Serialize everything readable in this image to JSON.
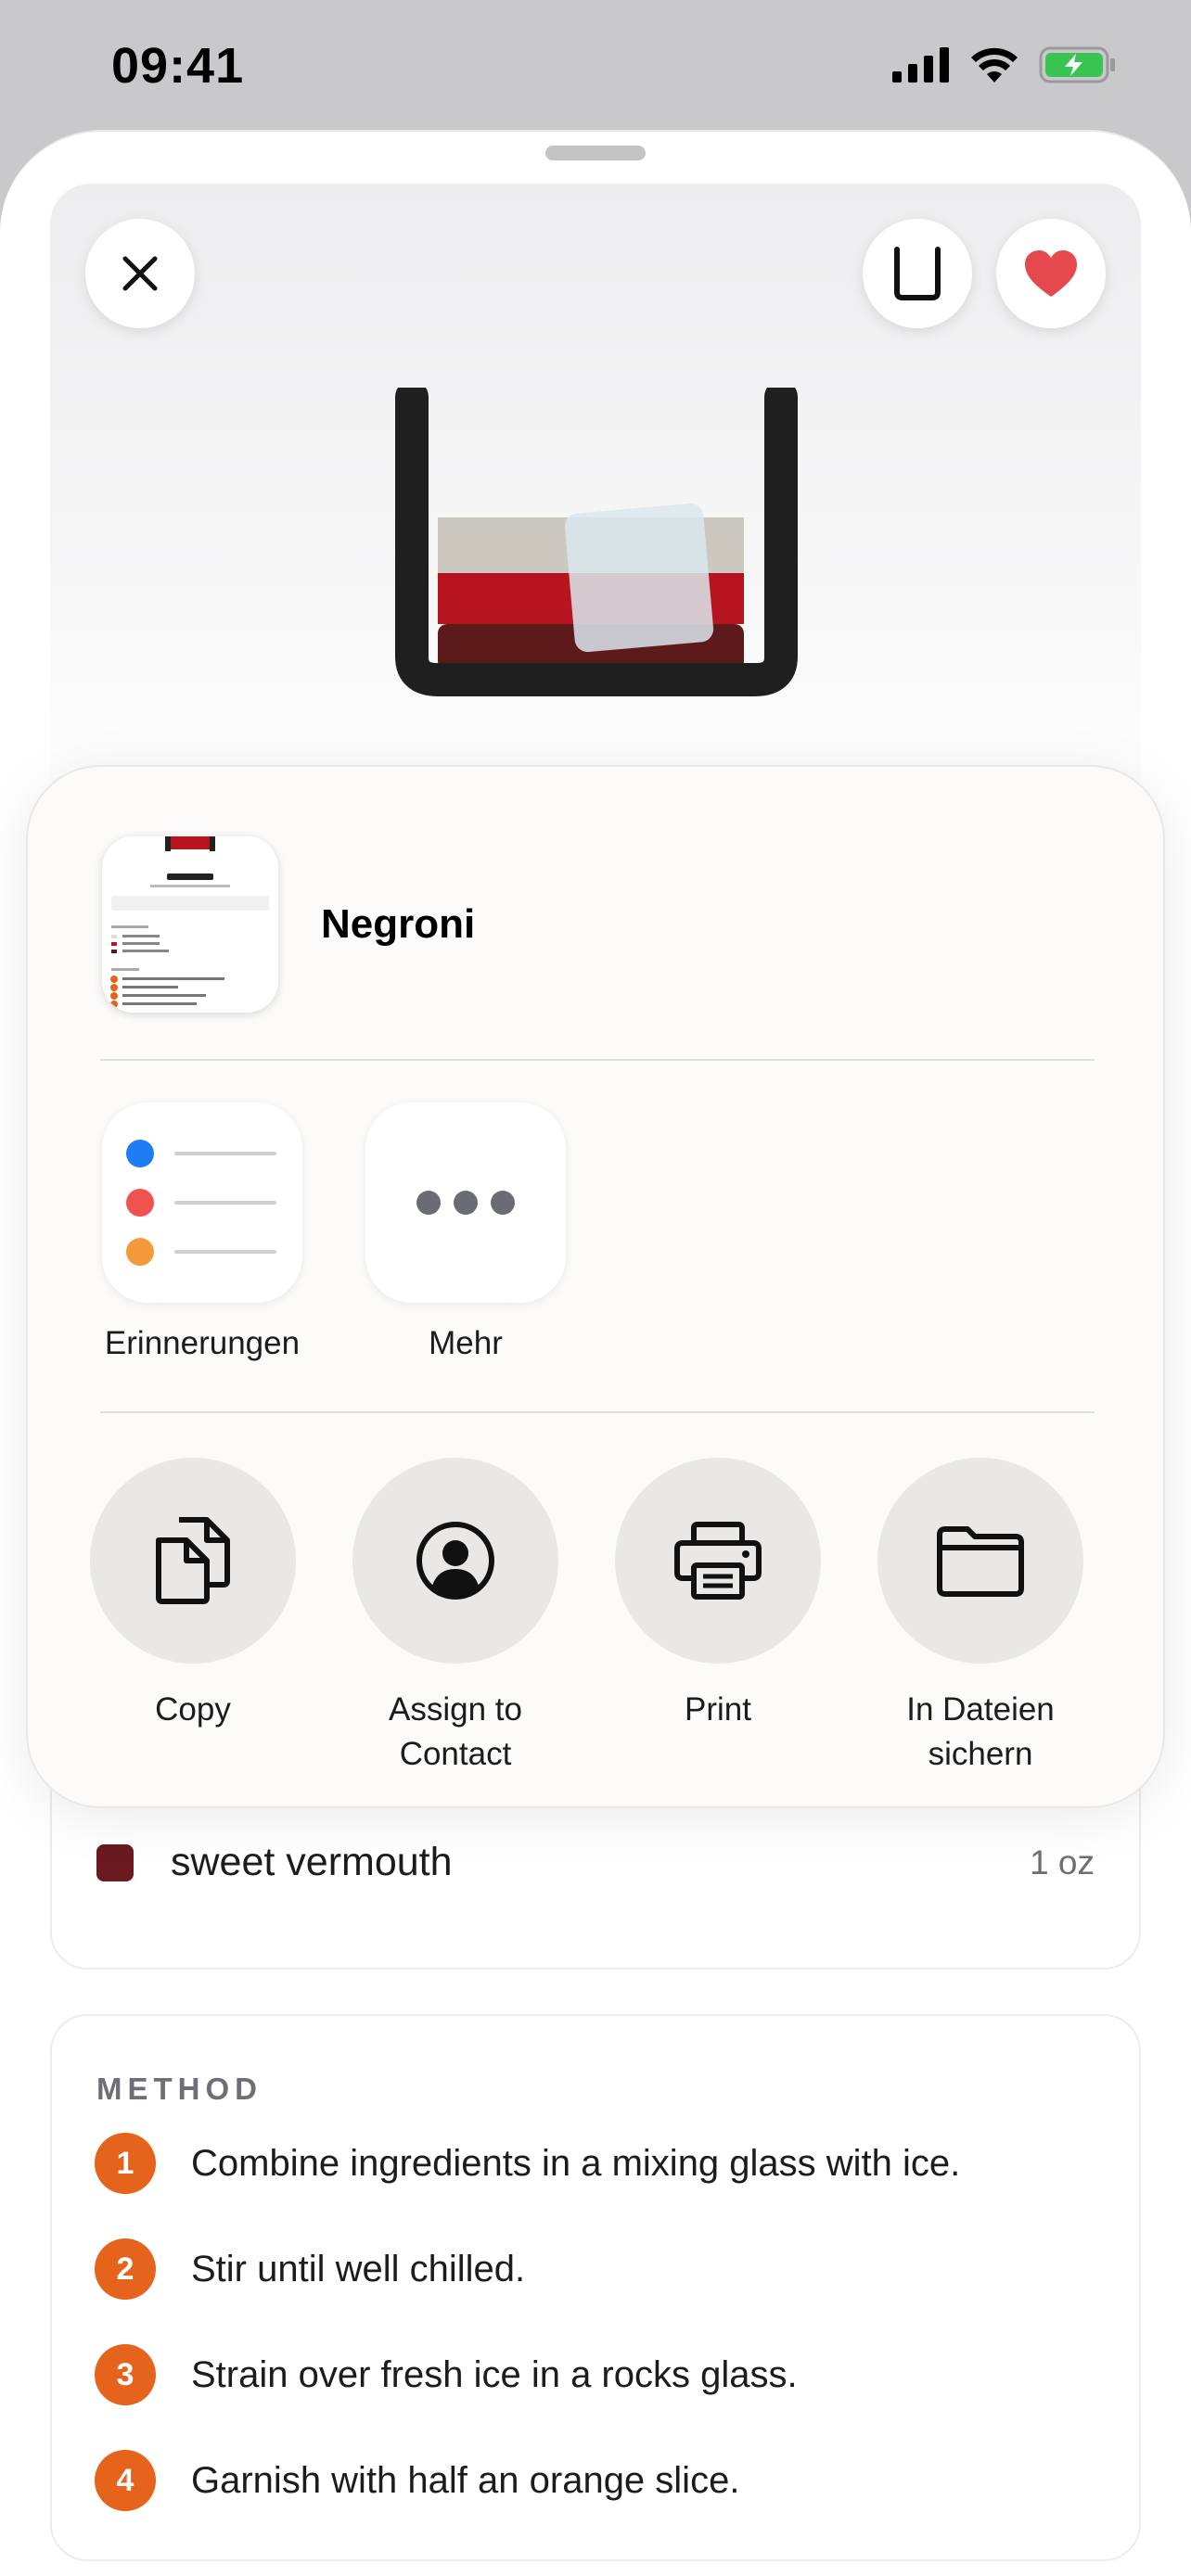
{
  "status_bar": {
    "time": "09:41",
    "icons": [
      "cellular-signal-icon",
      "wifi-icon",
      "battery-charging-icon"
    ]
  },
  "recipe": {
    "ingredients": [
      {
        "name": "sweet vermouth",
        "amount": "1 oz",
        "color": "#6b1a1f"
      }
    ],
    "method": {
      "title": "METHOD",
      "steps": [
        {
          "num": "1",
          "text": "Combine ingredients in a mixing glass with ice."
        },
        {
          "num": "2",
          "text": "Stir until well chilled."
        },
        {
          "num": "3",
          "text": "Strain over fresh ice in a rocks glass."
        },
        {
          "num": "4",
          "text": "Garnish with half an orange slice."
        }
      ]
    }
  },
  "share_sheet": {
    "title": "Negroni",
    "apps": [
      {
        "label": "Erinnerungen",
        "icon": "reminders-icon"
      },
      {
        "label": "Mehr",
        "icon": "more-icon"
      }
    ],
    "actions": [
      {
        "label": "Copy",
        "icon": "copy-icon"
      },
      {
        "label": "Assign to Contact",
        "icon": "contact-icon"
      },
      {
        "label": "Print",
        "icon": "printer-icon"
      },
      {
        "label": "In Dateien sichern",
        "icon": "folder-icon"
      }
    ]
  },
  "colors": {
    "accent_orange": "#e6631c",
    "heart_red": "#e5484d",
    "campari_red": "#b8141f",
    "vermouth_dark": "#5c1a1a",
    "gin_clear": "#cbc8bf"
  }
}
